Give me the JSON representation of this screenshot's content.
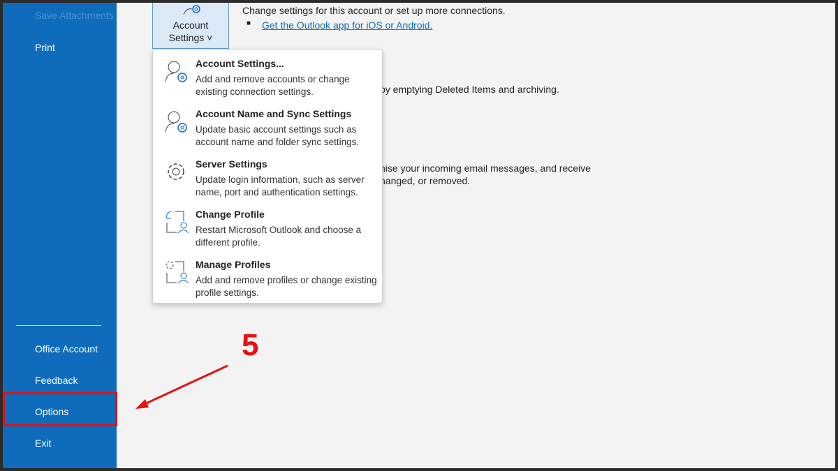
{
  "sidebar": {
    "items": [
      "Save Attachments",
      "Print",
      "Office Account",
      "Feedback",
      "Options",
      "Exit"
    ]
  },
  "account_button": {
    "line1": "Account",
    "line2": "Settings ˅"
  },
  "main": {
    "desc": "Change settings for this account or set up more connections.",
    "link": "Get the Outlook app for iOS or Android.",
    "mailbox_fragment": "by emptying Deleted Items and archiving.",
    "rules_fragment_1": "nise your incoming email messages, and receive",
    "rules_fragment_2": "hanged, or removed."
  },
  "menu": [
    {
      "title": "Account Settings...",
      "desc": "Add and remove accounts or change existing connection settings."
    },
    {
      "title": "Account Name and Sync Settings",
      "desc": "Update basic account settings such as account name and folder sync settings."
    },
    {
      "title": "Server Settings",
      "desc": "Update login information, such as server name, port and authentication settings."
    },
    {
      "title": "Change Profile",
      "desc": "Restart Microsoft Outlook and choose a different profile."
    },
    {
      "title": "Manage Profiles",
      "desc": "Add and remove profiles or change existing profile settings."
    }
  ],
  "annotation": {
    "step": "5"
  },
  "colors": {
    "accent": "#0f6cbd",
    "highlight": "#e81010"
  }
}
